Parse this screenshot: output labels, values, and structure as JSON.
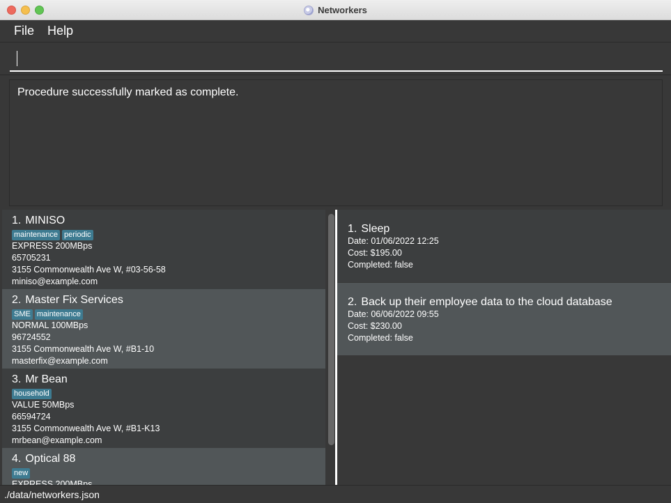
{
  "window": {
    "title": "Networkers"
  },
  "menu": {
    "file": "File",
    "help": "Help"
  },
  "command": {
    "value": "",
    "placeholder": ""
  },
  "result": {
    "message": "Procedure successfully marked as complete."
  },
  "clients": [
    {
      "index": "1.",
      "name": "MINISO",
      "tags": [
        "maintenance",
        "periodic"
      ],
      "plan": "EXPRESS 200MBps",
      "phone": "65705231",
      "address": "3155 Commonwealth Ave W, #03-56-58",
      "email": "miniso@example.com"
    },
    {
      "index": "2.",
      "name": "Master Fix Services",
      "tags": [
        "SME",
        "maintenance"
      ],
      "plan": "NORMAL 100MBps",
      "phone": "96724552",
      "address": "3155 Commonwealth Ave W, #B1-10",
      "email": "masterfix@example.com"
    },
    {
      "index": "3.",
      "name": "Mr Bean",
      "tags": [
        "household"
      ],
      "plan": "VALUE 50MBps",
      "phone": "66594724",
      "address": "3155 Commonwealth Ave W, #B1-K13",
      "email": "mrbean@example.com"
    },
    {
      "index": "4.",
      "name": "Optical 88",
      "tags": [
        "new"
      ],
      "plan": "EXPRESS 200MBps",
      "phone": "",
      "address": "",
      "email": ""
    }
  ],
  "procedures": [
    {
      "index": "1.",
      "title": "Sleep",
      "date": "Date: 01/06/2022 12:25",
      "cost": "Cost: $195.00",
      "completed": "Completed: false"
    },
    {
      "index": "2.",
      "title": "Back up their employee data to the cloud database",
      "date": "Date: 06/06/2022 09:55",
      "cost": "Cost: $230.00",
      "completed": "Completed: false"
    }
  ],
  "status": {
    "path": "./data/networkers.json"
  },
  "colors": {
    "background": "#383838",
    "card_alt": "#515658",
    "tag": "#3e7b91"
  }
}
